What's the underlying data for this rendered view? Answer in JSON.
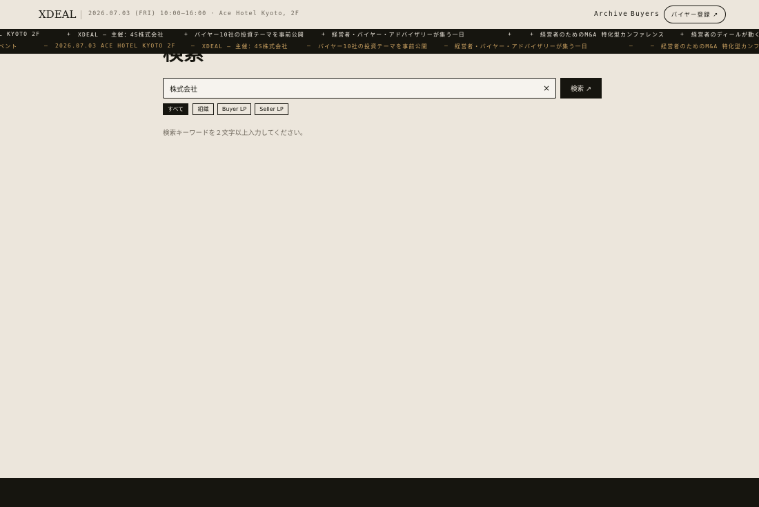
{
  "header": {
    "logo": "XDEAL",
    "event_info": "2026.07.03 (FRI) 10:00–16:00 · Ace Hotel Kyoto, 2F",
    "nav": {
      "archive": "Archive",
      "buyers": "Buyers"
    },
    "register_label": "バイヤー登録 ↗"
  },
  "ticker": {
    "row1": [
      "L KYOTO 2F",
      "+",
      "XDEAL — 主催：4S株式会社",
      "+",
      "バイヤー10社の投資テーマを事前公開",
      "+",
      "経営者・バイヤー・アドバイザリーが集う一日",
      "+",
      "+",
      "経営者のためのM&A 特化型カンファレンス",
      "+",
      "経営者のディールが動く"
    ],
    "row2": [
      "ベント",
      "—",
      "2026.07.03 ACE HOTEL KYOTO 2F",
      "—",
      "XDEAL — 主催：4S株式会社",
      "—",
      "バイヤー10社の投資テーマを事前公開",
      "—",
      "経営者・バイヤー・アドバイザリーが集う一日",
      "—",
      "—",
      "経営者のためのM&A 特化型カンファレン"
    ]
  },
  "main": {
    "title": "検索",
    "search": {
      "value": "株式会社",
      "placeholder": ""
    },
    "clear_label": "×",
    "search_button": "検索 ↗",
    "filters": [
      "すべて",
      "組織",
      "Buyer LP",
      "Seller LP"
    ],
    "hint": "検索キーワードを２文字以上入力してください。"
  },
  "colors": {
    "background": "#ece6dc",
    "ink": "#16150f",
    "ticker_accent": "#c9a060"
  }
}
